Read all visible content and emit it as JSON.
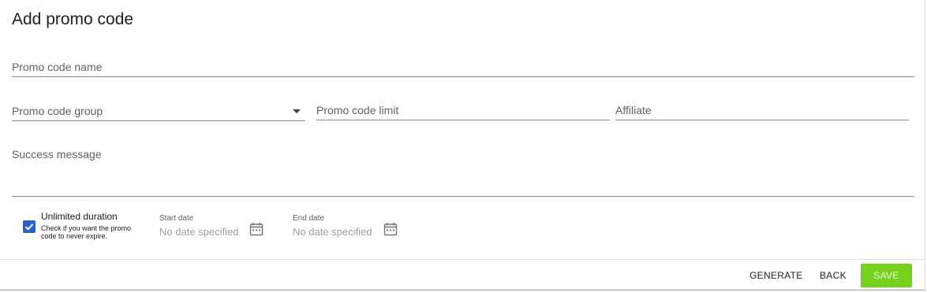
{
  "dialog": {
    "title": "Add promo code"
  },
  "fields": {
    "promo_code_name": "Promo code name",
    "promo_code_group": "Promo code group",
    "promo_code_limit": "Promo code limit",
    "affiliate": "Affiliate",
    "success_message": "Success message"
  },
  "duration": {
    "unlimited_label": "Unlimited duration",
    "unlimited_help": "Check if you want the promo code to never expire.",
    "unlimited_checked": true,
    "start_date_label": "Start date",
    "start_date_value": "No date specified",
    "end_date_label": "End date",
    "end_date_value": "No date specified"
  },
  "actions": {
    "generate": "GENERATE",
    "back": "BACK",
    "save": "SAVE"
  },
  "colors": {
    "save_button": "#76d21d",
    "checkbox": "#2a63c4"
  },
  "icons": {
    "checkbox": "check-icon",
    "dropdown": "chevron-down-icon",
    "date_picker": "calendar-icon"
  }
}
